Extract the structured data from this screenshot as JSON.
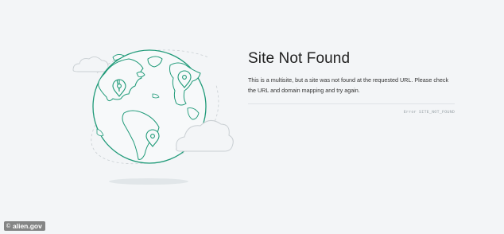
{
  "error_page": {
    "title": "Site Not Found",
    "message": "This is a multisite, but a site was not found at the requested URL. Please check the URL and domain mapping and try again.",
    "error_label": "Error",
    "error_code": "SITE_NOT_FOUND"
  },
  "illustration": {
    "icon": "globe-with-location-pins-illustration",
    "stroke_color": "#1f9a78",
    "cloud_color": "#c9cfd3"
  },
  "watermark": {
    "symbol": "©",
    "text": "alien.gov"
  },
  "colors": {
    "background": "#f3f5f7",
    "title": "#222222",
    "body": "#333333",
    "muted": "#9aa3a8"
  }
}
